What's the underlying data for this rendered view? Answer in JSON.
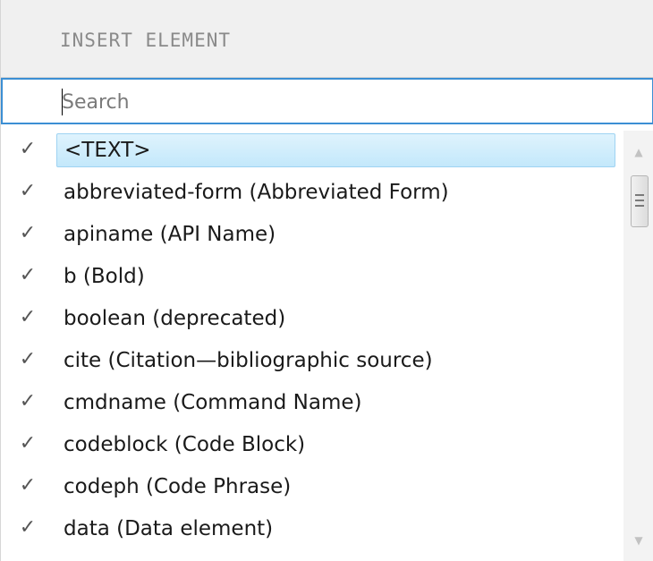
{
  "header": {
    "title": "INSERT ELEMENT"
  },
  "search": {
    "placeholder": "Search",
    "value": ""
  },
  "elements": {
    "check_glyph": "✓",
    "items": [
      {
        "label": "<TEXT>",
        "checked": true,
        "selected": true
      },
      {
        "label": "abbreviated-form (Abbreviated Form)",
        "checked": true,
        "selected": false
      },
      {
        "label": "apiname (API Name)",
        "checked": true,
        "selected": false
      },
      {
        "label": "b (Bold)",
        "checked": true,
        "selected": false
      },
      {
        "label": "boolean (deprecated)",
        "checked": true,
        "selected": false
      },
      {
        "label": "cite (Citation—bibliographic source)",
        "checked": true,
        "selected": false
      },
      {
        "label": "cmdname (Command Name)",
        "checked": true,
        "selected": false
      },
      {
        "label": "codeblock (Code Block)",
        "checked": true,
        "selected": false
      },
      {
        "label": "codeph (Code Phrase)",
        "checked": true,
        "selected": false
      },
      {
        "label": "data (Data element)",
        "checked": true,
        "selected": false
      }
    ]
  },
  "scrollbar": {
    "up_glyph": "▲",
    "down_glyph": "▼"
  },
  "colors": {
    "selection_fill": "#c3e8fb",
    "selection_border": "#9fd3f2",
    "search_border": "#3c8fd4",
    "header_bg": "#f0f0f0"
  }
}
